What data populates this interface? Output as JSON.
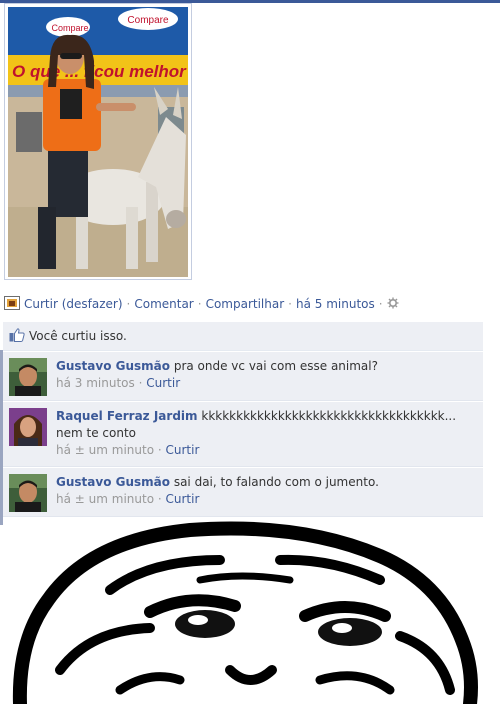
{
  "post": {
    "photo_alt": "photo",
    "photo_sign_brand": "Compare",
    "photo_sign_slogan": "O que ... ficou melhor"
  },
  "actions": {
    "like": "Curtir (desfazer)",
    "comment": "Comentar",
    "share": "Compartilhar",
    "time": "há 5 minutos"
  },
  "likes": {
    "text": "Você curtiu isso."
  },
  "comments": [
    {
      "author": "Gustavo Gusmão",
      "text": "pra onde vc vai com esse animal?",
      "time": "há 3 minutos",
      "like": "Curtir"
    },
    {
      "author": "Raquel Ferraz Jardim",
      "text": "kkkkkkkkkkkkkkkkkkkkkkkkkkkkkkkkkkk... nem te conto",
      "time": "há ± um minuto",
      "like": "Curtir"
    },
    {
      "author": "Gustavo Gusmão",
      "text": "sai dai, to falando com o jumento.",
      "time": "há ± um minuto",
      "like": "Curtir"
    }
  ],
  "icons": {
    "app": "app-icon",
    "like": "thumbs-up-icon",
    "settings": "gear-icon"
  },
  "colors": {
    "link": "#3b5998",
    "ufi_bg": "#edeff4",
    "muted": "#999999"
  }
}
